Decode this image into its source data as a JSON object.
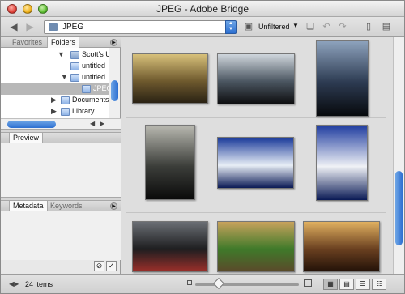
{
  "window": {
    "title": "JPEG - Adobe Bridge"
  },
  "toolbar": {
    "path": "JPEG",
    "filter": "Unfiltered"
  },
  "left_panel": {
    "tabs": [
      "Favorites",
      "Folders"
    ],
    "tree": [
      {
        "label": "Scott's U",
        "expanded": "down"
      },
      {
        "label": "untitled",
        "expanded": "none"
      },
      {
        "label": "untitled",
        "expanded": "down"
      },
      {
        "label": "JPEG",
        "expanded": "none",
        "selected": true
      },
      {
        "label": "Documents",
        "expanded": "right"
      },
      {
        "label": "Library",
        "expanded": "right"
      }
    ],
    "preview_tab": "Preview",
    "bottom_tabs": [
      "Metadata",
      "Keywords"
    ]
  },
  "content": {
    "thumbnails": [
      {
        "name": "london-skyline-sunset",
        "colors": [
          "#d7c07a",
          "#6f5a2e",
          "#2a2214"
        ]
      },
      {
        "name": "big-ben-silhouette-sky",
        "colors": [
          "#cfd6dc",
          "#4b5661",
          "#0e0e10"
        ]
      },
      {
        "name": "big-ben-night-river",
        "colors": [
          "#8da2bc",
          "#2d3b52",
          "#07090c"
        ]
      },
      {
        "name": "big-ben-dark-clouds",
        "colors": [
          "#b8b8b0",
          "#3c3e3a",
          "#0a0a0a"
        ]
      },
      {
        "name": "rotunda-blue-sky-1",
        "colors": [
          "#1a3a9a",
          "#e8eef6",
          "#0b1a55"
        ]
      },
      {
        "name": "rotunda-blue-sky-2",
        "colors": [
          "#203da0",
          "#f0f2f6",
          "#0a1a55"
        ]
      },
      {
        "name": "london-taxis-street",
        "colors": [
          "#6a6e74",
          "#1e1e20",
          "#9a2f2a"
        ]
      },
      {
        "name": "garden-lawn-sunset",
        "colors": [
          "#c7a25c",
          "#3f7a2a",
          "#5a4a2a"
        ]
      },
      {
        "name": "cathedral-interior",
        "colors": [
          "#e0b060",
          "#6a4020",
          "#231208"
        ]
      }
    ]
  },
  "status": {
    "item_count": "24 items"
  }
}
